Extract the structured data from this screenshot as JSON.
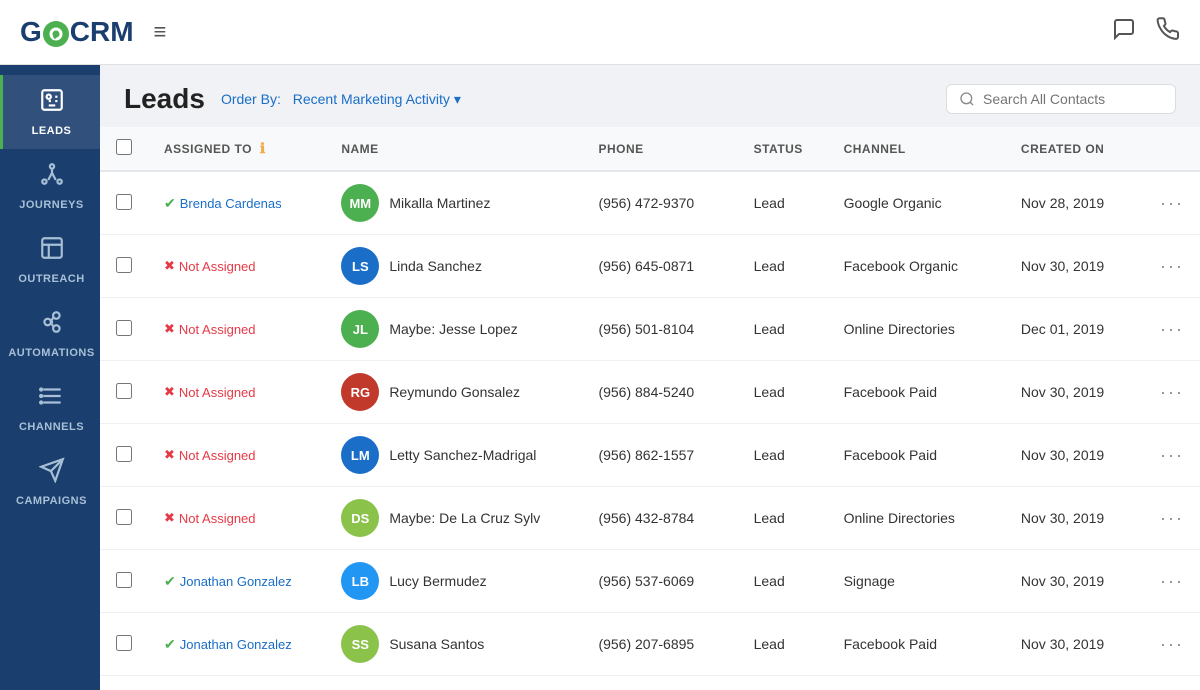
{
  "app": {
    "title": "GoCRM",
    "logo": {
      "go": "GO",
      "crm": "CRM"
    }
  },
  "topNav": {
    "hamburger": "≡",
    "chatIcon": "💬",
    "phoneIcon": "📞",
    "searchPlaceholder": "Search All Contacts"
  },
  "sidebar": {
    "items": [
      {
        "id": "leads",
        "label": "LEADS",
        "icon": "👤",
        "active": true
      },
      {
        "id": "journeys",
        "label": "JOURNEYS",
        "icon": "🗺️",
        "active": false
      },
      {
        "id": "outreach",
        "label": "OUTREACH",
        "icon": "📋",
        "active": false
      },
      {
        "id": "automations",
        "label": "AUTOMATIONS",
        "icon": "⚙️",
        "active": false
      },
      {
        "id": "channels",
        "label": "CHANNELS",
        "icon": "🔗",
        "active": false
      },
      {
        "id": "campaigns",
        "label": "CAMPAIGNS",
        "icon": "📢",
        "active": false
      }
    ]
  },
  "pageHeader": {
    "title": "Leads",
    "orderByLabel": "Order By:",
    "orderByValue": "Recent Marketing Activity",
    "dropdownArrow": "▾"
  },
  "table": {
    "columns": [
      {
        "id": "assigned",
        "label": "ASSIGNED TO"
      },
      {
        "id": "name",
        "label": "NAME"
      },
      {
        "id": "phone",
        "label": "PHONE"
      },
      {
        "id": "status",
        "label": "STATUS"
      },
      {
        "id": "channel",
        "label": "CHANNEL"
      },
      {
        "id": "created",
        "label": "CREATED ON"
      }
    ],
    "rows": [
      {
        "id": 1,
        "assignedTo": "Brenda Cardenas",
        "assignedType": "assigned",
        "avatarInitials": "MM",
        "avatarColor": "#4caf50",
        "name": "Mikalla Martinez",
        "phone": "(956) 472-9370",
        "status": "Lead",
        "channel": "Google Organic",
        "createdOn": "Nov 28, 2019"
      },
      {
        "id": 2,
        "assignedTo": "Not Assigned",
        "assignedType": "not-assigned",
        "avatarInitials": "LS",
        "avatarColor": "#1a6ec7",
        "name": "Linda Sanchez",
        "phone": "(956) 645-0871",
        "status": "Lead",
        "channel": "Facebook Organic",
        "createdOn": "Nov 30, 2019"
      },
      {
        "id": 3,
        "assignedTo": "Not Assigned",
        "assignedType": "not-assigned",
        "avatarInitials": "JL",
        "avatarColor": "#4caf50",
        "name": "Maybe: Jesse Lopez",
        "phone": "(956) 501-8104",
        "status": "Lead",
        "channel": "Online Directories",
        "createdOn": "Dec 01, 2019"
      },
      {
        "id": 4,
        "assignedTo": "Not Assigned",
        "assignedType": "not-assigned",
        "avatarInitials": "RG",
        "avatarColor": "#c0392b",
        "name": "Reymundo Gonsalez",
        "phone": "(956) 884-5240",
        "status": "Lead",
        "channel": "Facebook Paid",
        "createdOn": "Nov 30, 2019"
      },
      {
        "id": 5,
        "assignedTo": "Not Assigned",
        "assignedType": "not-assigned",
        "avatarInitials": "LM",
        "avatarColor": "#1a6ec7",
        "name": "Letty Sanchez-Madrigal",
        "phone": "(956) 862-1557",
        "status": "Lead",
        "channel": "Facebook Paid",
        "createdOn": "Nov 30, 2019"
      },
      {
        "id": 6,
        "assignedTo": "Not Assigned",
        "assignedType": "not-assigned",
        "avatarInitials": "DS",
        "avatarColor": "#8bc34a",
        "name": "Maybe: De La Cruz Sylv",
        "phone": "(956) 432-8784",
        "status": "Lead",
        "channel": "Online Directories",
        "createdOn": "Nov 30, 2019"
      },
      {
        "id": 7,
        "assignedTo": "Jonathan Gonzalez",
        "assignedType": "assigned",
        "avatarInitials": "LB",
        "avatarColor": "#2196f3",
        "name": "Lucy Bermudez",
        "phone": "(956) 537-6069",
        "status": "Lead",
        "channel": "Signage",
        "createdOn": "Nov 30, 2019"
      },
      {
        "id": 8,
        "assignedTo": "Jonathan Gonzalez",
        "assignedType": "assigned",
        "avatarInitials": "SS",
        "avatarColor": "#8bc34a",
        "name": "Susana Santos",
        "phone": "(956) 207-6895",
        "status": "Lead",
        "channel": "Facebook Paid",
        "createdOn": "Nov 30, 2019"
      }
    ]
  }
}
